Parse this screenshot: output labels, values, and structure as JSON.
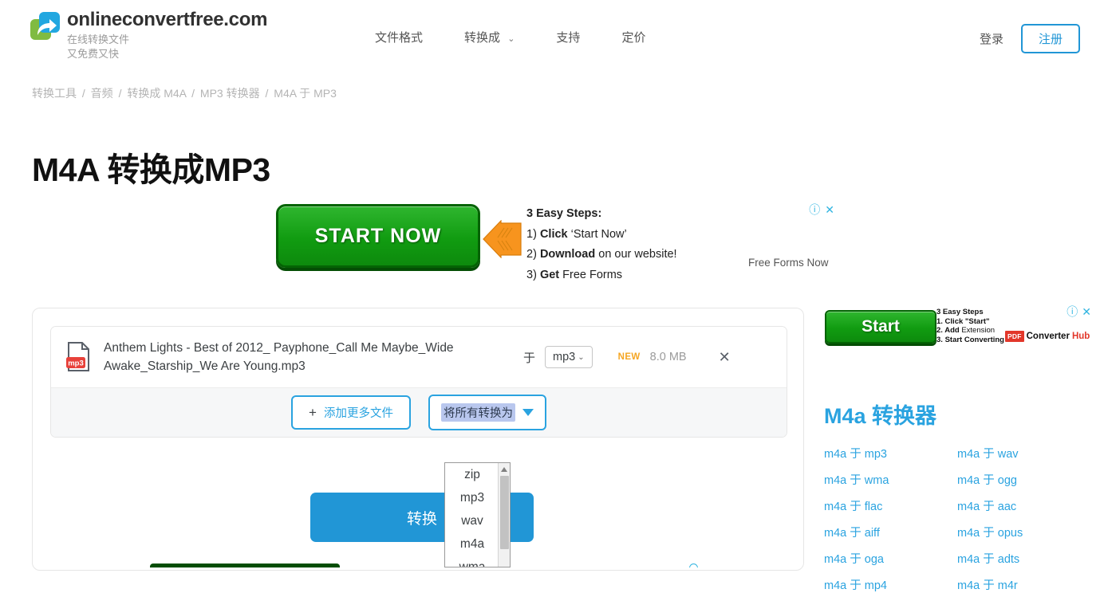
{
  "header": {
    "brand_title": "onlineconvertfree.com",
    "brand_sub_1": "在线转换文件",
    "brand_sub_2": "又免费又快",
    "nav": [
      {
        "label": "文件格式",
        "has_caret": false
      },
      {
        "label": "转换成",
        "has_caret": true
      },
      {
        "label": "支持",
        "has_caret": false
      },
      {
        "label": "定价",
        "has_caret": false
      }
    ],
    "login_label": "登录",
    "signup_label": "注册",
    "accent_color": "#2196d6"
  },
  "breadcrumb": {
    "items": [
      "转换工具",
      "音频",
      "转换成 M4A",
      "MP3 转换器",
      "M4A 于 MP3"
    ],
    "separator": "/"
  },
  "page": {
    "title": "M4A 转换成MP3"
  },
  "top_ad": {
    "button_label": "START NOW",
    "heading": "3 Easy Steps:",
    "step_1_num": "1)",
    "step_1_bold": "Click",
    "step_1_rest": "‘Start Now’",
    "step_2_num": "2)",
    "step_2_bold": "Download",
    "step_2_rest": "on our website!",
    "step_3_num": "3)",
    "step_3_bold": "Get",
    "step_3_rest": "Free Forms",
    "cta": "Free Forms Now",
    "info_glyph": "ⓘ",
    "close_glyph": "✕"
  },
  "converter": {
    "file": {
      "icon_label": "mp3",
      "name": "Anthem Lights - Best of 2012_ Payphone_Call Me Maybe_Wide Awake_Starship_We Are Young.mp3",
      "to_label": "于",
      "target_format": "mp3",
      "badge": "NEW",
      "size": "8.0 MB",
      "remove_glyph": "✕"
    },
    "add_files_label": "添加更多文件",
    "add_files_plus": "+",
    "convert_all_label": "将所有转换为",
    "convert_label": "转换"
  },
  "dropdown": {
    "options": [
      "zip",
      "mp3",
      "wav",
      "m4a",
      "wma"
    ],
    "selected": "mp3"
  },
  "right_ad": {
    "button_label": "Start",
    "heading": "3 Easy Steps",
    "step_1": "1. Click \"Start\"",
    "step_1_bold": "Click",
    "step_2_bold": "Add",
    "step_2_rest": "Extension",
    "step_3_bold": "Start Converting",
    "brand_pdf": "PDF",
    "brand_name": "Converter",
    "brand_suffix": "Hub",
    "info_glyph": "ⓘ",
    "close_glyph": "✕"
  },
  "sidebar": {
    "title": "M4a 转换器",
    "links": [
      "m4a 于 mp3",
      "m4a 于 wav",
      "m4a 于 wma",
      "m4a 于 ogg",
      "m4a 于 flac",
      "m4a 于 aac",
      "m4a 于 aiff",
      "m4a 于 opus",
      "m4a 于 oga",
      "m4a 于 adts",
      "m4a 于 mp4",
      "m4a 于 m4r"
    ]
  }
}
